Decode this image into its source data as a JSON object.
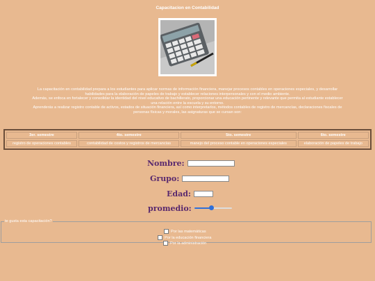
{
  "page": {
    "title": "Capacitacion en Contabilidad"
  },
  "intro": {
    "lines": [
      "La capacitación en contabilidad prepara a los estudiantes para aplicar normas de información financiera, manejar procesos contables en operaciones especiales, y desarrollar",
      "habilidades para la elaboración de papeles de trabajo y establecer relaciones interpersonales y con el medio ambiente.",
      "Además, se enfoca en fortalecer y consolidar la identidad del nivel educativo de bachillerato, proporcionar una educación pertinente y relevante que permita al estudiante establecer",
      "una relación entre la escuela y su entorno.",
      "Aprenderás a realizar registro contable de activos, estados de situación financiera, así como interpretarlos, métodos contables de registro de mercancías, declaraciones fiscales de",
      "personas físicas y morales, las asignaturas que se cursan son:"
    ]
  },
  "table": {
    "headers": [
      "3er. semestre",
      "4to. semestre",
      "5to. semestre",
      "6to. semestre"
    ],
    "cells": [
      "registro de operaciones contables",
      "contabilidad de costos y registros de mercancías",
      "manejo del proceso contable en operaciones especiales",
      "elaboración de papeles de trabajo"
    ]
  },
  "form": {
    "nombre_label": "Nombre:",
    "grupo_label": "Grupo:",
    "edad_label": "Edad:",
    "promedio_label": "promedio:",
    "promedio_fraction": 0.45
  },
  "question": {
    "legend": "te gusta esta capacitación?",
    "options": [
      "Por las matemáticas",
      "Por la educación financiera",
      "Por la administración"
    ]
  },
  "colors": {
    "background": "#e8b990",
    "label": "#5a2a6e",
    "accent": "#2f6fd8"
  }
}
